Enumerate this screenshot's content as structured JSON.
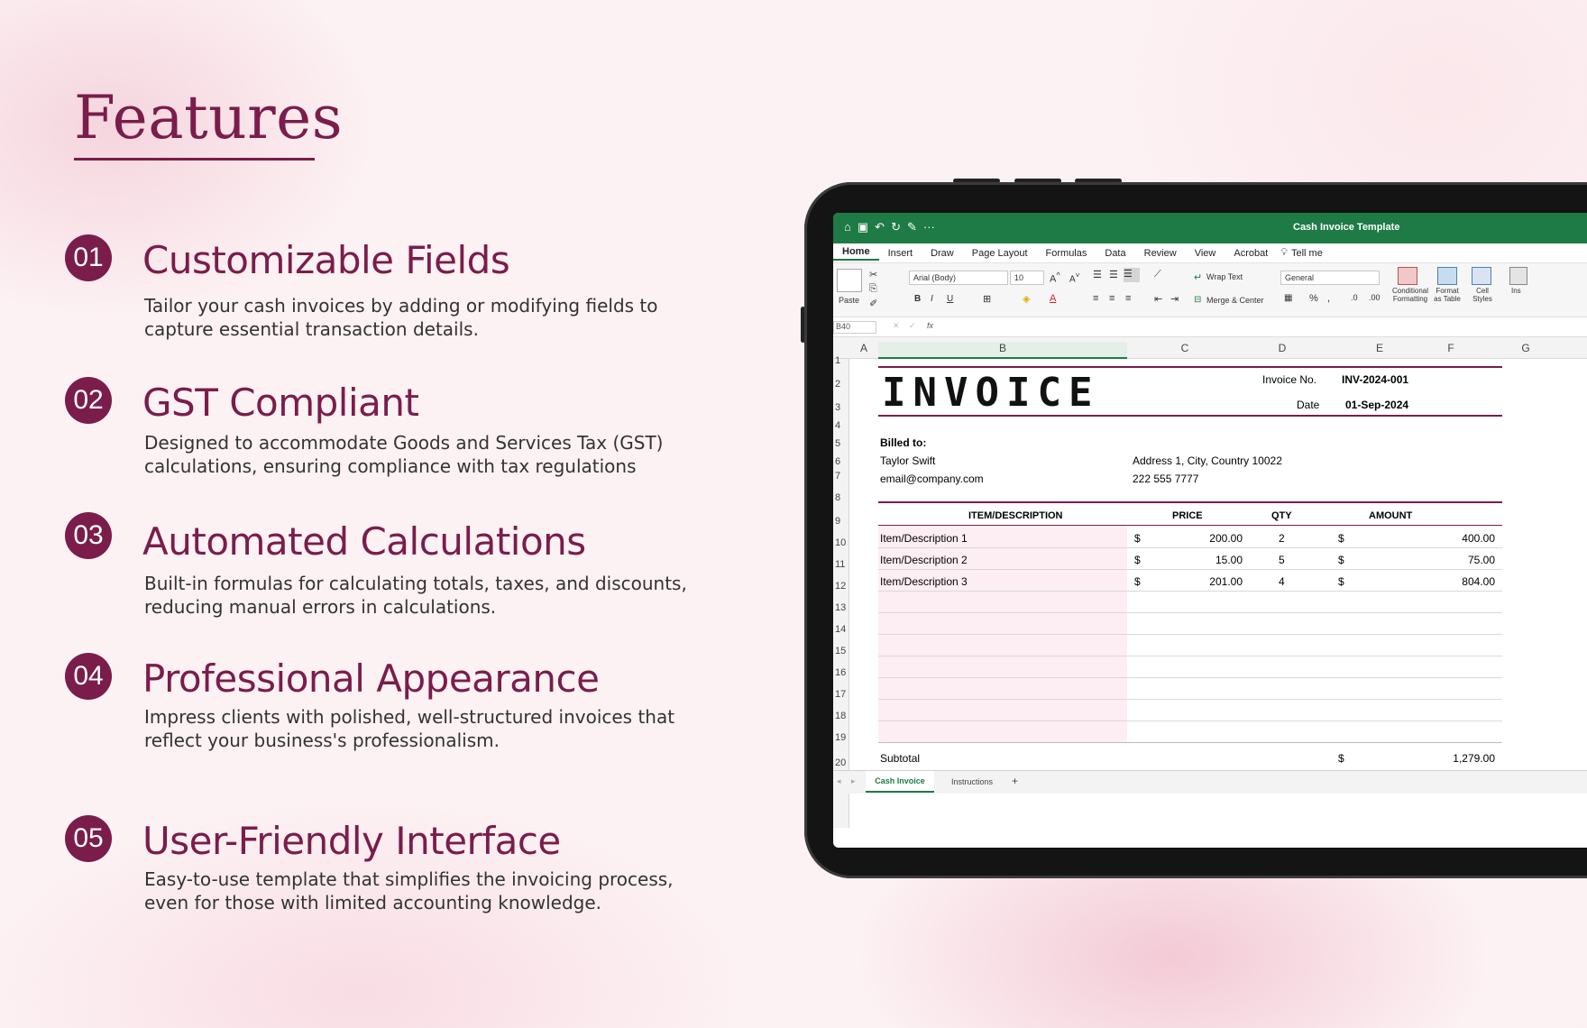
{
  "heading": "Features",
  "features": [
    {
      "num": "01",
      "title": "Customizable Fields",
      "desc": "Tailor your cash invoices by adding or modifying fields to capture essential transaction details."
    },
    {
      "num": "02",
      "title": "GST Compliant",
      "desc": "Designed to accommodate Goods and Services Tax (GST) calculations, ensuring compliance with tax regulations"
    },
    {
      "num": "03",
      "title": "Automated Calculations",
      "desc": "Built-in formulas for calculating totals, taxes, and discounts, reducing manual errors in calculations."
    },
    {
      "num": "04",
      "title": "Professional Appearance",
      "desc": "Impress clients with polished, well-structured invoices that reflect your business's professionalism."
    },
    {
      "num": "05",
      "title": "User-Friendly Interface",
      "desc": "Easy-to-use template that simplifies the invoicing process, even for those with limited accounting knowledge."
    }
  ],
  "excel": {
    "window_title": "Cash Invoice Template",
    "menu": [
      "Home",
      "Insert",
      "Draw",
      "Page Layout",
      "Formulas",
      "Data",
      "Review",
      "View",
      "Acrobat",
      "Tell me"
    ],
    "ribbon": {
      "paste": "Paste",
      "font": "Arial (Body)",
      "font_size": "10",
      "wrap_text": "Wrap Text",
      "merge_center": "Merge & Center",
      "number_format": "General",
      "conditional_formatting": "Conditional Formatting",
      "format_as_table": "Format as Table",
      "cell_styles": "Cell Styles",
      "insert": "Ins"
    },
    "name_box": "B40",
    "fx": "fx",
    "columns": [
      "A",
      "B",
      "C",
      "D",
      "E",
      "F",
      "G"
    ],
    "rows": [
      "1",
      "2",
      "3",
      "4",
      "5",
      "6",
      "7",
      "8",
      "9",
      "10",
      "11",
      "12",
      "13",
      "14",
      "15",
      "16",
      "17",
      "18",
      "19",
      "20"
    ],
    "invoice": {
      "title": "INVOICE",
      "invoice_no_label": "Invoice No.",
      "invoice_no": "INV-2024-001",
      "date_label": "Date",
      "date": "01-Sep-2024",
      "billed_to_label": "Billed to:",
      "client_name": "Taylor Swift",
      "client_email": "email@company.com",
      "client_address": "Address 1, City, Country 10022",
      "client_phone": "222 555 7777",
      "headers": {
        "item": "ITEM/DESCRIPTION",
        "price": "PRICE",
        "qty": "QTY",
        "amount": "AMOUNT"
      },
      "currency": "$",
      "items": [
        {
          "desc": "Item/Description 1",
          "price": "200.00",
          "qty": "2",
          "amount": "400.00"
        },
        {
          "desc": "Item/Description 2",
          "price": "15.00",
          "qty": "5",
          "amount": "75.00"
        },
        {
          "desc": "Item/Description 3",
          "price": "201.00",
          "qty": "4",
          "amount": "804.00"
        }
      ],
      "subtotal_label": "Subtotal",
      "subtotal": "1,279.00"
    },
    "sheets": [
      "Cash Invoice",
      "Instructions"
    ],
    "add_sheet": "+"
  },
  "colors": {
    "brand": "#7a1d4a",
    "excel_green": "#1e7b45",
    "row_pink": "#fdeef3"
  }
}
